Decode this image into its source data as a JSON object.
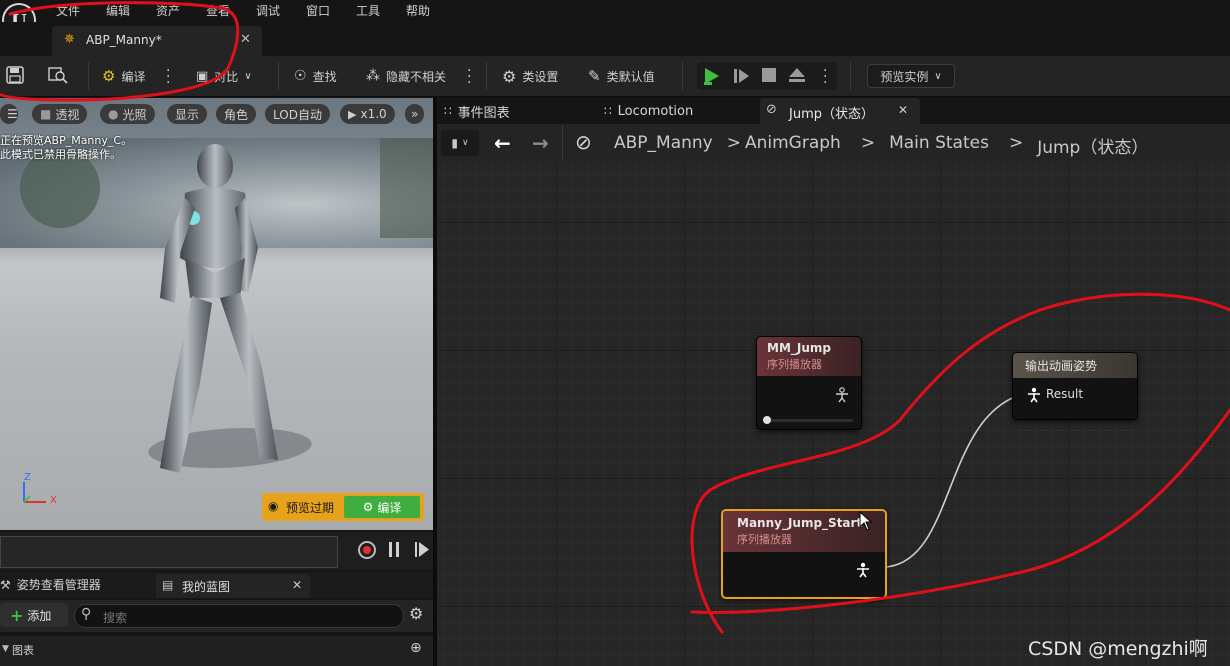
{
  "menu": [
    "文件",
    "编辑",
    "资产",
    "查看",
    "调试",
    "窗口",
    "工具",
    "帮助"
  ],
  "asset_tab": {
    "label": "ABP_Manny*"
  },
  "toolbar": {
    "compile": "编译",
    "diff": "对比",
    "find": "查找",
    "hide_unrelated": "隐藏不相关",
    "class_settings": "类设置",
    "class_defaults": "类默认值",
    "preview_instance": "预览实例"
  },
  "viewport": {
    "perspective": "透视",
    "lit": "光照",
    "show": "显示",
    "character": "角色",
    "lod": "LOD自动",
    "speed": "x1.0",
    "overlay_line1": "正在预览ABP_Manny_C。",
    "overlay_line2": "此模式已禁用骨骼操作。",
    "axis_z": "Z",
    "axis_x": "X",
    "preview_expired": "预览过期",
    "compile_btn": "编译"
  },
  "bottom": {
    "tab_pose_watch": "姿势查看管理器",
    "tab_my_blueprint": "我的蓝图",
    "add": "添加",
    "search_placeholder": "搜索",
    "graphs": "图表"
  },
  "graph_tabs": [
    "事件图表",
    "Locomotion",
    "Jump（状态）"
  ],
  "breadcrumb": [
    "ABP_Manny",
    "AnimGraph",
    "Main States",
    "Jump（状态）"
  ],
  "nodes": {
    "mm_jump": {
      "title": "MM_Jump",
      "subtitle": "序列播放器"
    },
    "output": {
      "title": "输出动画姿势",
      "pin": "Result"
    },
    "jump_start": {
      "title": "Manny_Jump_Start",
      "subtitle": "序列播放器"
    }
  },
  "watermark": "CSDN @mengzhi啊",
  "colors": {
    "annotation": "#e0101a",
    "play": "#3fbf3f",
    "selected_border": "#e6a21a",
    "node_header": "#6a3438"
  }
}
